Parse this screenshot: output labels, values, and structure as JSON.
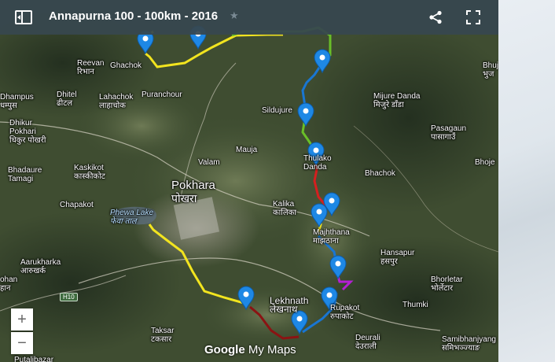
{
  "header": {
    "title": "Annapurna 100 - 100km - 2016",
    "star_icon": "star-icon",
    "menu_icon": "toggle-legend-icon",
    "share_icon": "share-icon",
    "fullscreen_icon": "fullscreen-icon"
  },
  "places": [
    {
      "id": "bhuj",
      "name": "Bhuj",
      "local": "भुज"
    },
    {
      "id": "reevan",
      "name": "Reevan",
      "local": "रिभान"
    },
    {
      "id": "ghachok",
      "name": "Ghachok",
      "local": ""
    },
    {
      "id": "dhampus",
      "name": "Dhampus",
      "local": "धम्पुस"
    },
    {
      "id": "dhitel",
      "name": "Dhitel",
      "local": "ढीटल"
    },
    {
      "id": "lahachok",
      "name": "Lahachok",
      "local": "लाहाचोक"
    },
    {
      "id": "puranchour",
      "name": "Puranchour",
      "local": ""
    },
    {
      "id": "mijure",
      "name": "Mijure Danda",
      "local": "मिजुरे डाँडा"
    },
    {
      "id": "sildujure",
      "name": "Sildujure",
      "local": ""
    },
    {
      "id": "dhikur",
      "name": "Dhikur Pokhari",
      "local": "धिकुर पोखरी"
    },
    {
      "id": "pasagaun",
      "name": "Pasagaun",
      "local": "पासागाउँ"
    },
    {
      "id": "mauja",
      "name": "Mauja",
      "local": ""
    },
    {
      "id": "thulako",
      "name": "Thulako Danda",
      "local": ""
    },
    {
      "id": "bhadaure",
      "name": "Bhadaure Tamagi",
      "local": ""
    },
    {
      "id": "kaskikot",
      "name": "Kaskikot",
      "local": "कास्कीकोट"
    },
    {
      "id": "valam",
      "name": "Valam",
      "local": ""
    },
    {
      "id": "bhachok",
      "name": "Bhachok",
      "local": ""
    },
    {
      "id": "bhoje",
      "name": "Bhoje",
      "local": ""
    },
    {
      "id": "pokhara",
      "name": "Pokhara",
      "local": "पोखरा"
    },
    {
      "id": "kalika",
      "name": "Kalika",
      "local": "कालिका"
    },
    {
      "id": "chapakot",
      "name": "Chapakot",
      "local": ""
    },
    {
      "id": "phewa",
      "name": "Phewa Lake",
      "local": "फेवा ताल"
    },
    {
      "id": "majhthana",
      "name": "Majhthana",
      "local": "माझठाना"
    },
    {
      "id": "hansapur",
      "name": "Hansapur",
      "local": "हसपुर"
    },
    {
      "id": "aarukharka",
      "name": "Aarukharka",
      "local": "आरुखर्क"
    },
    {
      "id": "bhorletar",
      "name": "Bhorletar",
      "local": "भोर्लेटार"
    },
    {
      "id": "ohan",
      "name": "ohan",
      "local": "हान"
    },
    {
      "id": "thumki",
      "name": "Thumki",
      "local": ""
    },
    {
      "id": "lekhnath",
      "name": "Lekhnath",
      "local": "लेखनाथ"
    },
    {
      "id": "rupakot",
      "name": "Rupakot",
      "local": "रुपाकोट"
    },
    {
      "id": "taksar",
      "name": "Taksar",
      "local": "टकसार"
    },
    {
      "id": "deurali",
      "name": "Deurali",
      "local": "देउराली"
    },
    {
      "id": "samibhanjyang",
      "name": "Samibhanjyang",
      "local": "समिभञ्ज्याङ"
    },
    {
      "id": "putalibazar",
      "name": "Putalibazar",
      "local": ""
    }
  ],
  "highway": "H10",
  "zoom": {
    "in": "+",
    "out": "−"
  },
  "logo": {
    "google": "Google",
    "mymaps": "My Maps"
  },
  "colors": {
    "header": "#37474f",
    "marker": "#1e88e5",
    "segment_yellow": "#f2e41f",
    "segment_green": "#6abe28",
    "segment_blue": "#1976d2",
    "segment_red": "#d41f1f",
    "segment_purple": "#b51fd4",
    "segment_darkred": "#8b1313"
  }
}
